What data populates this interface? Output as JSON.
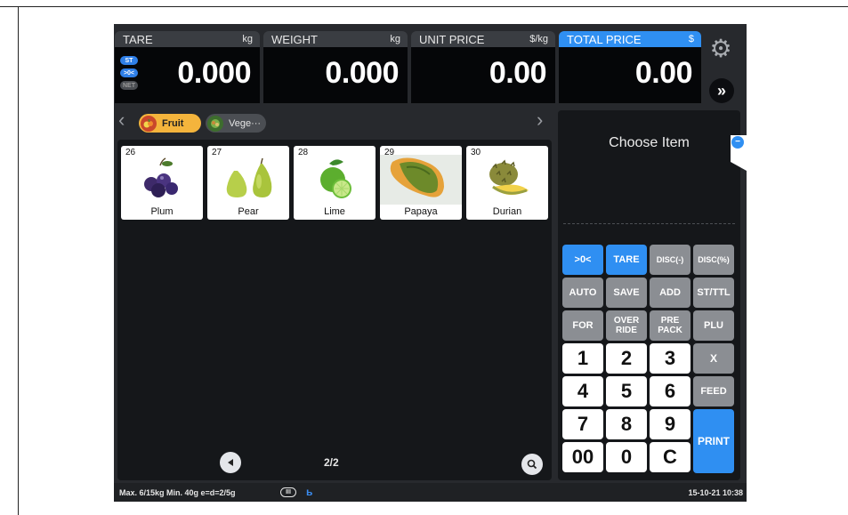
{
  "displays": {
    "tare": {
      "label": "TARE",
      "unit": "kg",
      "value": "0.000"
    },
    "weight": {
      "label": "WEIGHT",
      "unit": "kg",
      "value": "0.000"
    },
    "unit_price": {
      "label": "UNIT PRICE",
      "unit": "$/kg",
      "value": "0.00"
    },
    "total_price": {
      "label": "TOTAL PRICE",
      "unit": "$",
      "value": "0.00"
    }
  },
  "indicators": {
    "st": "ST",
    "zero": ">0<",
    "net": "NET"
  },
  "nav": {
    "forward": "»",
    "prev": "‹",
    "next": "›"
  },
  "categories": [
    {
      "label": "Fruit",
      "icon": "fruit-icon",
      "active": true
    },
    {
      "label": "Vege···",
      "icon": "vegetable-icon",
      "active": false
    }
  ],
  "items": [
    {
      "number": "26",
      "name": "Plum"
    },
    {
      "number": "27",
      "name": "Pear"
    },
    {
      "number": "28",
      "name": "Lime"
    },
    {
      "number": "29",
      "name": "Papaya"
    },
    {
      "number": "30",
      "name": "Durian"
    }
  ],
  "pagination": {
    "label": "2/2"
  },
  "choose_item": "Choose Item",
  "keypad": {
    "zero": ">0<",
    "tare": "TARE",
    "disc_minus": "DISC(-)",
    "disc_pct": "DISC(%)",
    "auto": "AUTO",
    "save": "SAVE",
    "add": "ADD",
    "st_ttl": "ST/TTL",
    "for": "FOR",
    "override_1": "OVER",
    "override_2": "RIDE",
    "prepack_1": "PRE",
    "prepack_2": "PACK",
    "plu": "PLU",
    "n1": "1",
    "n2": "2",
    "n3": "3",
    "x": "X",
    "n4": "4",
    "n5": "5",
    "n6": "6",
    "feed": "FEED",
    "n7": "7",
    "n8": "8",
    "n9": "9",
    "print": "PRINT",
    "n00": "00",
    "n0": "0",
    "c": "C"
  },
  "status": {
    "spec": "Max. 6/15kg  Min. 40g  e=d=2/5g",
    "class": "III",
    "datetime": "15-10-21 10:38"
  },
  "colors": {
    "accent": "#2f8ff2",
    "fruit_tab": "#f4b43c",
    "key_gray": "#8b8e93"
  }
}
